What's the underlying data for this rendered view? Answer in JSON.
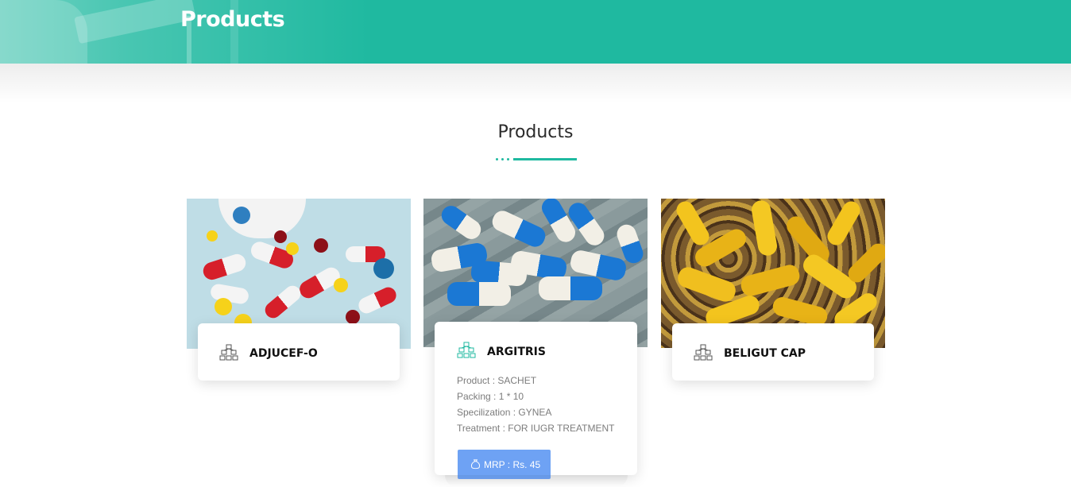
{
  "header": {
    "title": "Products"
  },
  "section": {
    "title": "Products"
  },
  "products": [
    {
      "name": "ADJUCEF-O",
      "icon": "medicine-box-icon"
    },
    {
      "name": "ARGITRIS",
      "icon": "medicine-box-icon",
      "details": {
        "product": "Product : SACHET",
        "packing": "Packing : 1 * 10",
        "specialization": "Specilization : GYNEA",
        "treatment": "Treatment : FOR IUGR TREATMENT"
      },
      "mrp_label": "MRP : Rs. 45"
    },
    {
      "name": "BELIGUT CAP",
      "icon": "medicine-box-icon"
    }
  ],
  "colors": {
    "accent": "#1fb9a0",
    "button": "#6ea2f4",
    "heading": "#2b2b2b",
    "detail_text": "#7c7c7c"
  }
}
